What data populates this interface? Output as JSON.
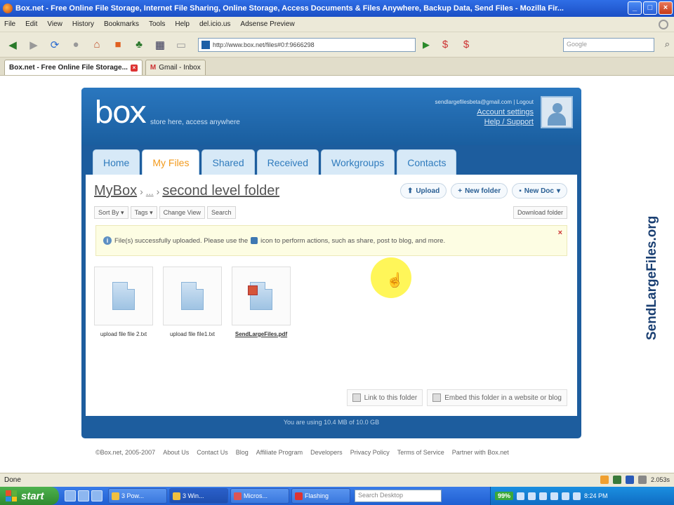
{
  "window": {
    "title": "Box.net - Free Online File Storage, Internet File Sharing, Online Storage, Access Documents & Files Anywhere, Backup Data, Send Files - Mozilla Fir..."
  },
  "menu": [
    "File",
    "Edit",
    "View",
    "History",
    "Bookmarks",
    "Tools",
    "Help",
    "del.icio.us",
    "Adsense Preview"
  ],
  "address": {
    "url": "http://www.box.net/files#0:f:9666298",
    "search_placeholder": "Google"
  },
  "browser_tabs": [
    {
      "label": "Box.net - Free Online File Storage..."
    },
    {
      "label": "Gmail - Inbox"
    }
  ],
  "box": {
    "logo": "box",
    "tagline": "store here, access anywhere",
    "account": {
      "email": "sendlargefilesbeta@gmail.com | Logout",
      "settings": "Account settings",
      "help": "Help / Support"
    },
    "tabs": [
      "Home",
      "My Files",
      "Shared",
      "Received",
      "Workgroups",
      "Contacts"
    ],
    "active_tab": "My Files",
    "breadcrumb": {
      "root": "MyBox",
      "ellipsis": "...",
      "current": "second level folder"
    },
    "actions": {
      "upload": "Upload",
      "new_folder": "New folder",
      "new_doc": "New Doc"
    },
    "tools": [
      "Sort By",
      "Tags",
      "Change View",
      "Search"
    ],
    "download_folder": "Download folder",
    "notice": {
      "before": "File(s) successfully uploaded. Please use the",
      "after": "icon to perform actions, such as share, post to blog, and more."
    },
    "files": [
      {
        "name": "upload file file 2.txt",
        "kind": "doc"
      },
      {
        "name": "upload file file1.txt",
        "kind": "doc"
      },
      {
        "name": "SendLargeFiles.pdf",
        "kind": "pdf"
      }
    ],
    "link_folder": "Link to this folder",
    "embed_folder": "Embed this folder in a website or blog",
    "usage": "You are using 10.4 MB of 10.0 GB"
  },
  "footer_links": [
    "©Box.net, 2005-2007",
    "About Us",
    "Contact Us",
    "Blog",
    "Affiliate Program",
    "Developers",
    "Privacy Policy",
    "Terms of Service",
    "Partner with Box.net"
  ],
  "watermark": "SendLargeFiles.org",
  "status": {
    "text": "Done",
    "right_text": "2.053s"
  },
  "taskbar": {
    "start": "start",
    "items": [
      "3 Pow...",
      "3 Win...",
      "Micros...",
      "Flashing"
    ],
    "search_placeholder": "Search Desktop",
    "battery": "99%",
    "clock": "8:24 PM"
  }
}
